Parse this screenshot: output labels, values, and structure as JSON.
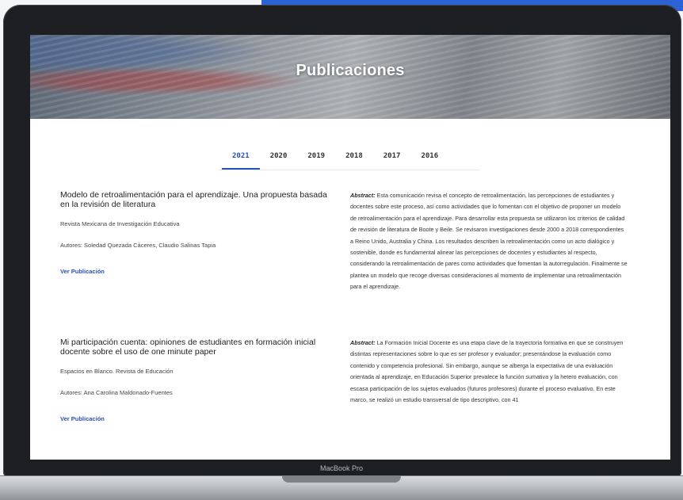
{
  "hero": {
    "title": "Publicaciones"
  },
  "tabs": [
    {
      "label": "2021",
      "active": true
    },
    {
      "label": "2020",
      "active": false
    },
    {
      "label": "2019",
      "active": false
    },
    {
      "label": "2018",
      "active": false
    },
    {
      "label": "2017",
      "active": false
    },
    {
      "label": "2016",
      "active": false
    }
  ],
  "publications": [
    {
      "title": "Modelo de retroalimentación para el aprendizaje. Una propuesta basada en la revisión de literatura",
      "journal": "Revista Mexicana de Investigación Educativa",
      "authors": "Autores: Soledad Quezada Cáceres, Claudio Salinas Tapia",
      "link_label": "Ver Publicación",
      "abstract_label": "Abstract:",
      "abstract": "Esta comunicación revisa el concepto de retroalimentación, las percepciones de estudiantes y docentes sobre este proceso, así como actividades que lo fomentan con el objetivo de proponer un modelo de retroalimentación para el aprendizaje. Para desarrollar esta propuesta se utilizaron los criterios de calidad de revisión de literatura de Boote y Beile. Se revisaron investigaciones desde 2000 a 2018 correspondientes a Reino Unido, Australia y China. Los resultados describen la retroalimentación como un acto dialógico y sostenible, donde es fundamental alinear las percepciones de docentes y estudiantes al respecto, considerando la retroalimentación de pares como actividades que fomentan la autorregulación. Finalmente se plantea un modelo que recoge diversas consideraciones al momento de implementar una retroalimentación para el aprendizaje."
    },
    {
      "title": "Mi participación cuenta: opiniones de estudiantes en formación inicial docente sobre el uso de one minute paper",
      "journal": "Espacios en Blanco. Revista de Educación",
      "authors": "Autores: Ana Carolina Maldonado-Fuentes",
      "link_label": "Ver Publicación",
      "abstract_label": "Abstract:",
      "abstract": "La Formación Inicial Docente es una etapa clave de la trayectoria formativa en que se construyen distintas representaciones sobre lo que es ser profesor y evaluador; presentándose la evaluación como contenido y competencia profesional. Sin embargo, aunque se alberga la expectativa de una evaluación orientada al aprendizaje, en Educación Superior prevalece la función sumativa y la hetero evaluación, con escasa participación de los sujetos evaluados (futuros profesores) durante el proceso evaluativo. En este marco, se realizó un estudio transversal de tipo descriptivo, con 41"
    }
  ],
  "device": {
    "brand_label": "MacBook Pro"
  }
}
